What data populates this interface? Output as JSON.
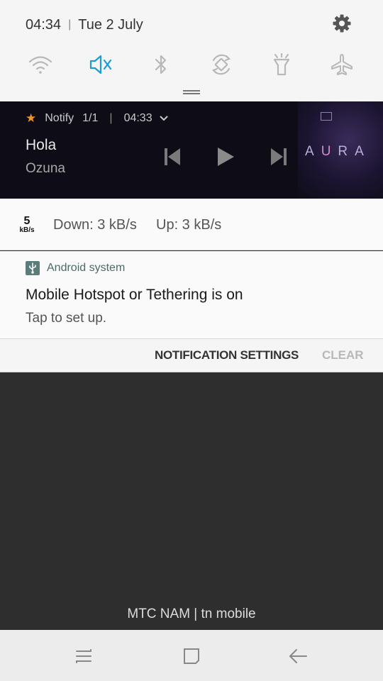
{
  "status": {
    "time": "04:34",
    "separator": "|",
    "date": "Tue 2 July"
  },
  "quick_settings": {
    "icons": [
      "wifi-icon",
      "sound-mute-icon",
      "bluetooth-icon",
      "auto-rotate-icon",
      "flashlight-icon",
      "airplane-mode-icon"
    ],
    "active_color": "#1e9bd4",
    "inactive_color": "#b0b0b0"
  },
  "media": {
    "app": "Notify",
    "page": "1/1",
    "separator": "|",
    "time": "04:33",
    "title": "Hola",
    "artist": "Ozuna",
    "art_text_a": "A",
    "art_text_u": "U",
    "art_text_rest": "RA"
  },
  "netspeed": {
    "icon_value": "5",
    "icon_unit": "kB/s",
    "down": "Down: 3 kB/s",
    "up": "Up: 3 kB/s"
  },
  "system_notification": {
    "app": "Android system",
    "title": "Mobile Hotspot or Tethering is on",
    "text": "Tap to set up."
  },
  "actions": {
    "settings_label": "NOTIFICATION SETTINGS",
    "clear_label": "CLEAR"
  },
  "carrier": "MTC NAM | tn mobile"
}
